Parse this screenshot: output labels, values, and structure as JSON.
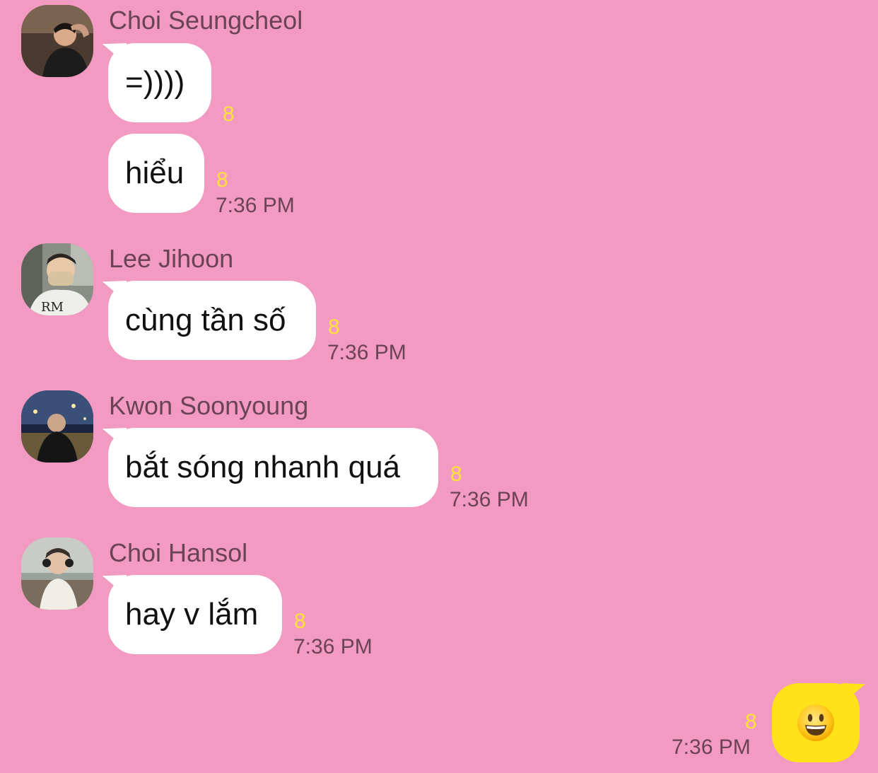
{
  "messages": [
    {
      "sender": "Choi Seungcheol",
      "avatar_icon": "profile-photo-icon",
      "bubbles": [
        {
          "text": "=))))",
          "unread": "8"
        },
        {
          "text": "hiểu",
          "unread": "8",
          "time": "7:36 PM"
        }
      ]
    },
    {
      "sender": "Lee Jihoon",
      "avatar_icon": "profile-photo-icon",
      "bubbles": [
        {
          "text": "cùng tần số",
          "unread": "8",
          "time": "7:36 PM"
        }
      ]
    },
    {
      "sender": "Kwon Soonyoung",
      "avatar_icon": "profile-photo-icon",
      "bubbles": [
        {
          "text": "bắt sóng nhanh quá",
          "unread": "8",
          "time": "7:36 PM"
        }
      ]
    },
    {
      "sender": "Choi Hansol",
      "avatar_icon": "profile-photo-icon",
      "bubbles": [
        {
          "text": "hay v lắm",
          "unread": "8",
          "time": "7:36 PM"
        }
      ]
    }
  ],
  "my_message": {
    "emoji_icon": "smiling-face-emoji-icon",
    "unread": "8",
    "time": "7:36 PM"
  },
  "colors": {
    "background": "#f29ac2",
    "incoming_bubble": "#ffffff",
    "outgoing_bubble": "#ffe21a",
    "unread_count": "#ffe33b",
    "sender_name": "#6b4356"
  }
}
